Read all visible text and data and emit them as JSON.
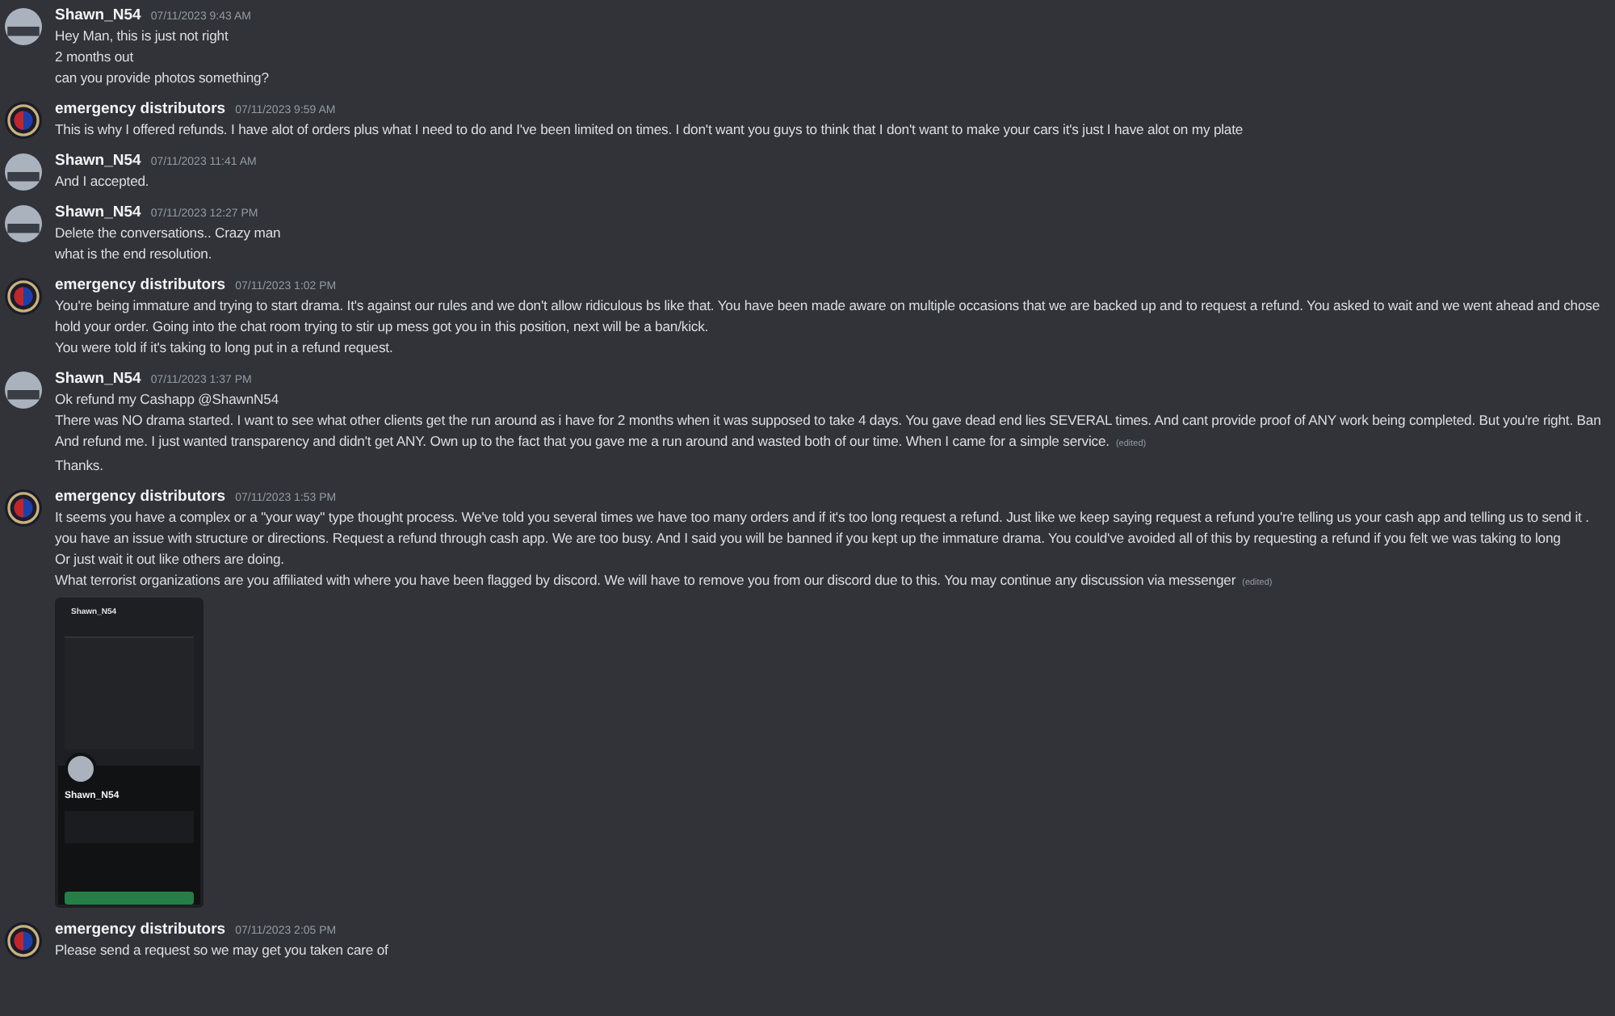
{
  "messages": [
    {
      "author": "Shawn_N54",
      "time": "07/11/2023 9:43 AM",
      "avatar": {
        "kind": "photo"
      },
      "lines": [
        {
          "text": "Hey Man, this is just not right"
        },
        {
          "text": "2 months out"
        },
        {
          "text": "can you provide photos something?"
        }
      ]
    },
    {
      "author": "emergency distributors",
      "time": "07/11/2023 9:59 AM",
      "avatar": {
        "kind": "logo"
      },
      "lines": [
        {
          "text": "This is why I offered refunds. I have alot of orders plus what I need to do and I've been limited on times. I don't want you guys to think that I don't want to make your cars it's just I have alot on my plate"
        }
      ]
    },
    {
      "author": "Shawn_N54",
      "time": "07/11/2023 11:41 AM",
      "avatar": {
        "kind": "photo"
      },
      "lines": [
        {
          "text": "And I accepted."
        }
      ]
    },
    {
      "author": "Shawn_N54",
      "time": "07/11/2023 12:27 PM",
      "avatar": {
        "kind": "photo"
      },
      "lines": [
        {
          "text": "Delete the conversations.. Crazy man"
        },
        {
          "text": "what is the end resolution."
        }
      ]
    },
    {
      "author": "emergency distributors",
      "time": "07/11/2023 1:02 PM",
      "avatar": {
        "kind": "logo"
      },
      "lines": [
        {
          "text": "You're being immature and trying to start drama. It's against our rules and we don't allow ridiculous bs like that. You have been made aware on multiple occasions that we are backed up and to request a refund. You asked to wait and we went ahead and chose"
        },
        {
          "text": "hold your order. Going into the chat room trying to stir up mess got you in this position,  next will be a ban/kick."
        },
        {
          "text": "You were told if it's taking to long put in a refund request."
        }
      ]
    },
    {
      "author": "Shawn_N54",
      "time": "07/11/2023 1:37 PM",
      "avatar": {
        "kind": "photo"
      },
      "lines": [
        {
          "text": "Ok refund my Cashapp @ShawnN54"
        },
        {
          "text": "There was NO drama started. I want to see what other clients get the run around as i have for 2 months when it was supposed to take 4 days. You gave dead end lies SEVERAL times. And cant provide proof of ANY work being completed. But you're right. Ban"
        },
        {
          "text": "And refund me. I just wanted transparency and didn't get ANY. Own up to the fact that you gave me a run around and wasted both of our time. When I came for a simple service.",
          "edited_label": "(edited)"
        },
        {
          "text": "Thanks."
        }
      ]
    },
    {
      "author": "emergency distributors",
      "time": "07/11/2023 1:53 PM",
      "avatar": {
        "kind": "logo"
      },
      "lines": [
        {
          "text": "It seems you have a complex or a \"your way\" type thought process. We've told you several times we have too many orders and if it's too long request a refund. Just like we keep saying request a refund you're telling us your cash app and telling us to send it ."
        },
        {
          "text": "you have an issue with structure or directions. Request a refund through cash app. We are too busy.  And I said you will be banned if you kept up the immature drama. You could've avoided all of this by requesting a refund if you felt we was taking to long"
        },
        {
          "text": "Or just wait it out like others are doing."
        },
        {
          "text": "What terrorist organizations are you affiliated with where you have been flagged by discord. We will have to remove you from our discord due to this. You may continue any discussion via messenger",
          "edited_label": "(edited)"
        }
      ],
      "attachment": {
        "header_name": "Shawn_N54",
        "profile_name": "Shawn_N54"
      }
    },
    {
      "author": "emergency distributors",
      "time": "07/11/2023 2:05 PM",
      "avatar": {
        "kind": "logo"
      },
      "lines": [
        {
          "text": "Please send a request so we may get you taken care of"
        }
      ]
    }
  ]
}
